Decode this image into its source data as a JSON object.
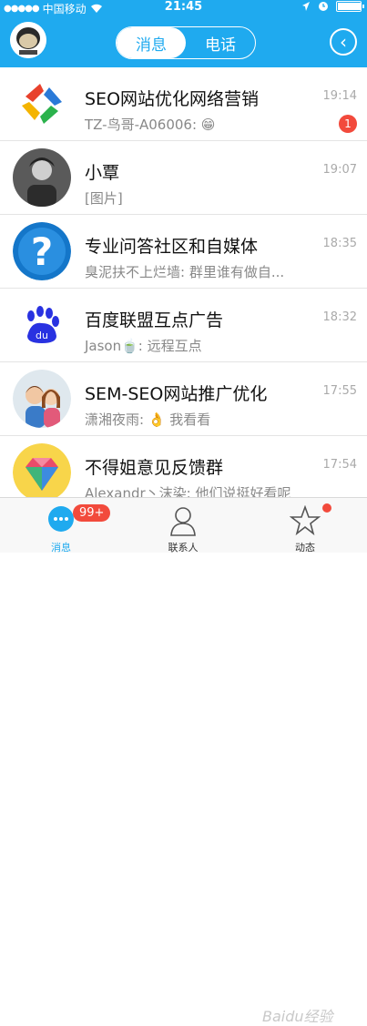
{
  "status_bar": {
    "carrier": "中国移动",
    "time": "21:45"
  },
  "header": {
    "tabs": [
      "消息",
      "电话"
    ],
    "active_tab": 0
  },
  "conversations": [
    {
      "name": "SEO网站优化网络营销",
      "message": "TZ-鸟哥-A06006: 😁",
      "time": "19:14",
      "badge": "1"
    },
    {
      "name": "小覃",
      "message": "[图片]",
      "time": "19:07",
      "badge": ""
    },
    {
      "name": "专业问答社区和自媒体",
      "message": "臭泥扶不上烂墙: 群里谁有做自...",
      "time": "18:35",
      "badge": ""
    },
    {
      "name": "百度联盟互点广告",
      "message": "Jason🍵: 远程互点",
      "time": "18:32",
      "badge": ""
    },
    {
      "name": "SEM-SEO网站推广优化",
      "message": "潇湘夜雨: 👌 我看看",
      "time": "17:55",
      "badge": ""
    },
    {
      "name": "不得姐意见反馈群",
      "message": "Alexandr丶沫染: 他们说挺好看呢",
      "time": "17:54",
      "badge": ""
    }
  ],
  "tabbar": {
    "tabs": [
      {
        "label": "消息",
        "badge": "99+"
      },
      {
        "label": "联系人",
        "badge": ""
      },
      {
        "label": "动态",
        "badge": ""
      }
    ],
    "active": 0
  },
  "colors": {
    "accent": "#1faaef",
    "badge": "#f24a3c"
  },
  "watermark": "Baidu经验"
}
